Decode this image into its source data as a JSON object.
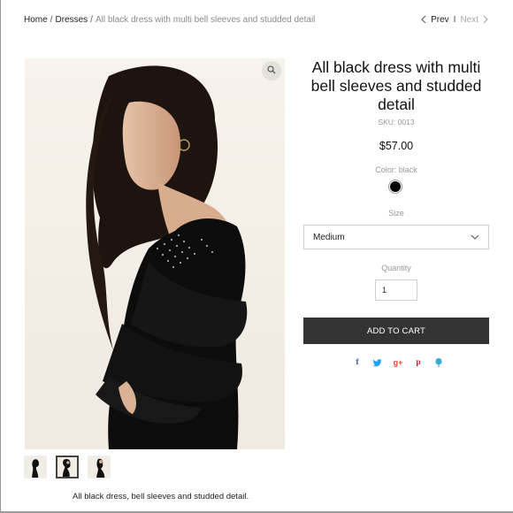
{
  "breadcrumb": {
    "home": "Home",
    "separator": "/",
    "category": "Dresses",
    "current": "All black dress with multi bell sleeves and studded detail"
  },
  "pager": {
    "prev": "Prev",
    "divider": "I",
    "next": "Next"
  },
  "product": {
    "title": "All black dress with multi bell sleeves and studded detail",
    "sku": "SKU: 0013",
    "price": "$57.00",
    "color_label": "Color: black",
    "color_swatch": "#000000",
    "size_label": "Size",
    "size_selected": "Medium",
    "quantity_label": "Quantity",
    "quantity_value": "1",
    "add_to_cart": "ADD TO CART",
    "description": "All black dress, bell sleeves and studded detail."
  },
  "share": [
    {
      "icon": "facebook-icon",
      "glyph": "f",
      "color": "#3b5998"
    },
    {
      "icon": "twitter-icon",
      "glyph": "t",
      "color": "#1da1f2"
    },
    {
      "icon": "google-plus-icon",
      "glyph": "g+",
      "color": "#dd4b39"
    },
    {
      "icon": "pinterest-icon",
      "glyph": "p",
      "color": "#cb2027"
    },
    {
      "icon": "fancy-icon",
      "glyph": "•",
      "color": "#3aa8d8"
    }
  ],
  "images": {
    "thumbnail_count": 3,
    "active_thumbnail": 2
  },
  "colors": {
    "button_bg": "#333333",
    "muted_text": "#999999"
  }
}
